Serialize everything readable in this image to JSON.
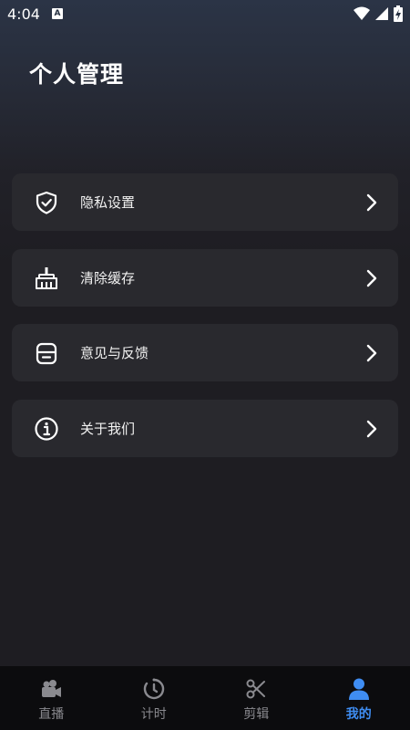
{
  "status_bar": {
    "time": "4:04",
    "app_badge": "A",
    "icons": [
      "wifi-icon",
      "signal-icon",
      "battery-icon"
    ]
  },
  "header": {
    "title": "个人管理"
  },
  "menu": {
    "items": [
      {
        "label": "隐私设置",
        "icon": "shield-icon"
      },
      {
        "label": "清除缓存",
        "icon": "broom-icon"
      },
      {
        "label": "意见与反馈",
        "icon": "feedback-icon"
      },
      {
        "label": "关于我们",
        "icon": "info-icon"
      }
    ]
  },
  "tabbar": {
    "tabs": [
      {
        "label": "直播",
        "icon": "video-camera-icon",
        "active": false
      },
      {
        "label": "计时",
        "icon": "timer-icon",
        "active": false
      },
      {
        "label": "剪辑",
        "icon": "scissors-icon",
        "active": false
      },
      {
        "label": "我的",
        "icon": "user-icon",
        "active": true
      }
    ],
    "active_color": "#3f8df2",
    "inactive_color": "#8a8a8f"
  },
  "colors": {
    "background": "#1e1d22",
    "card": "#29292e",
    "tabbar": "#0c0c0e"
  }
}
